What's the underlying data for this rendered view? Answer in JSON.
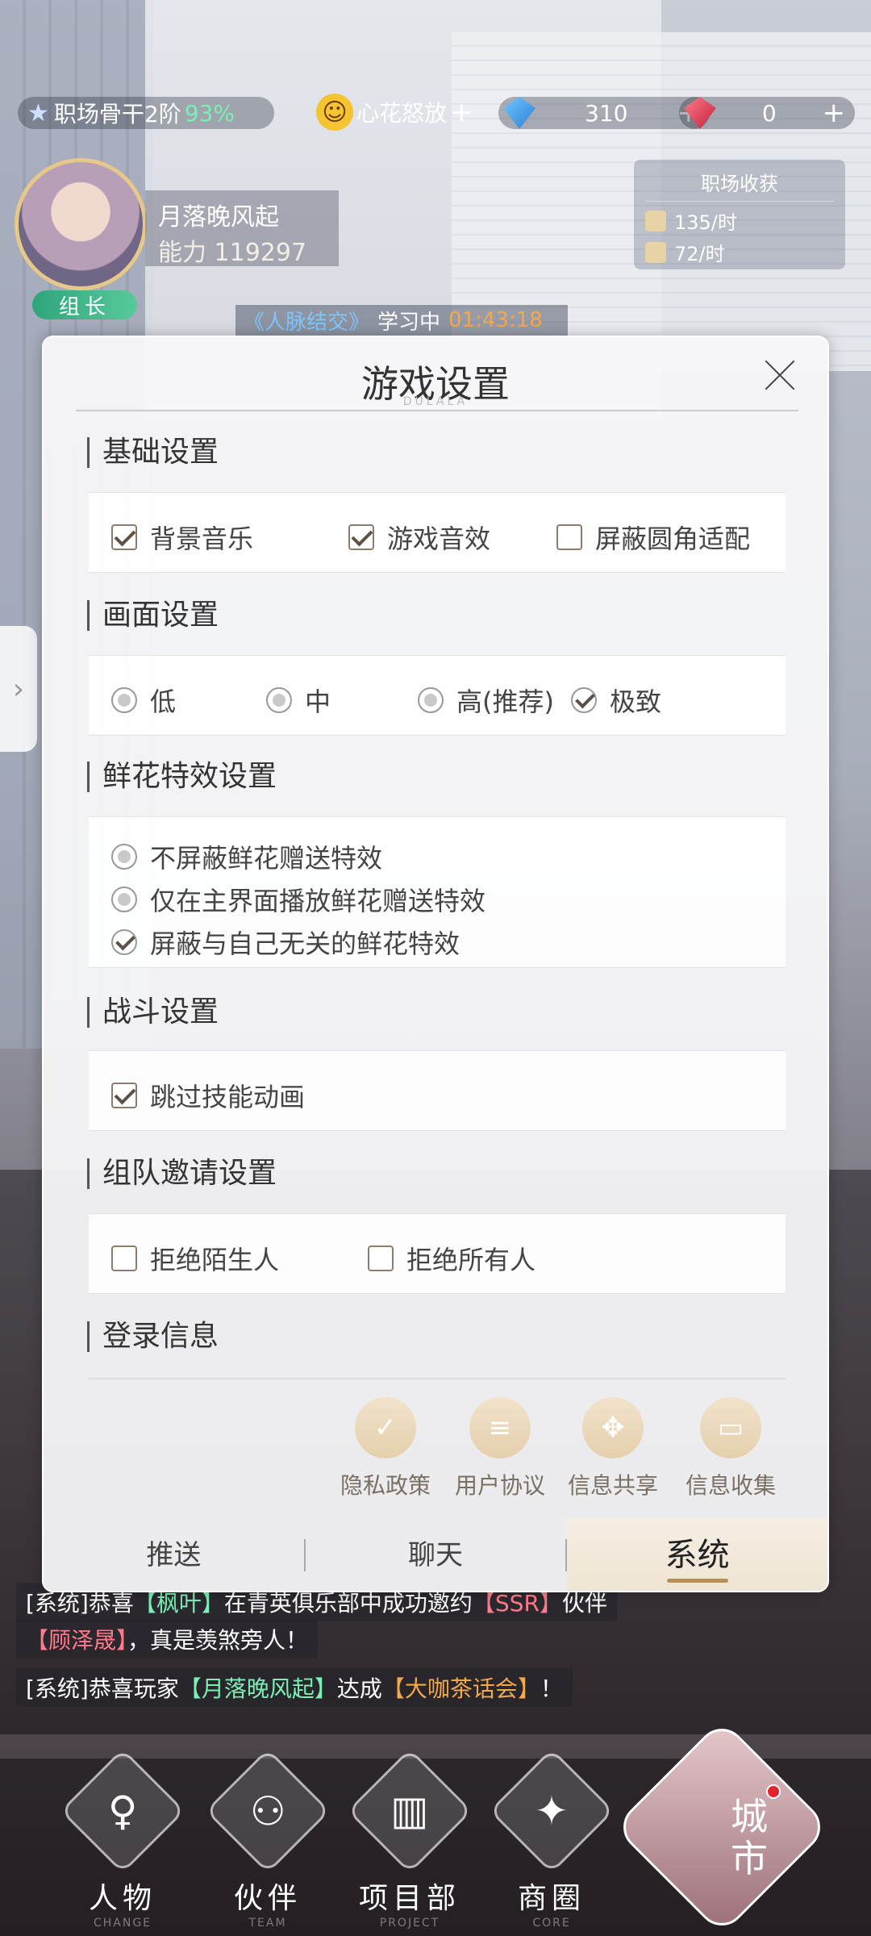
{
  "top_bar": {
    "rank_label": "职场骨干2阶",
    "rank_percent": "93%",
    "mood_label": "心花怒放",
    "mood_plus": "+",
    "blue_gem_count": "310",
    "blue_gem_plus": "+",
    "red_gem_count": "0",
    "red_gem_plus": "+"
  },
  "player": {
    "name": "月落晚风起",
    "power": "能力 119297",
    "role_badge": "组长"
  },
  "harvest": {
    "title": "职场收获",
    "rate_1": "135/时",
    "rate_2": "72/时"
  },
  "learn_banner": {
    "book": "《人脉结交》",
    "status": "学习中",
    "timer": "01:43:18"
  },
  "dialog": {
    "title": "游戏设置",
    "subtitle": "DULALA",
    "sections": {
      "basic": {
        "heading": "基础设置",
        "bg_music": "背景音乐",
        "game_sfx": "游戏音效",
        "round_corner": "屏蔽圆角适配"
      },
      "graphics": {
        "heading": "画面设置",
        "low": "低",
        "mid": "中",
        "high": "高(推荐)",
        "ultra": "极致"
      },
      "flower": {
        "heading": "鲜花特效设置",
        "opt1": "不屏蔽鲜花赠送特效",
        "opt2": "仅在主界面播放鲜花赠送特效",
        "opt3": "屏蔽与自己无关的鲜花特效"
      },
      "battle": {
        "heading": "战斗设置",
        "skip_anim": "跳过技能动画"
      },
      "team": {
        "heading": "组队邀请设置",
        "reject_strangers": "拒绝陌生人",
        "reject_all": "拒绝所有人"
      },
      "login": {
        "heading": "登录信息",
        "privacy": "隐私政策",
        "agreement": "用户协议",
        "info_share": "信息共享",
        "info_collect": "信息收集"
      }
    },
    "tabs": [
      "推送",
      "聊天",
      "系统"
    ]
  },
  "chat": {
    "line1_prefix": "[系统]恭喜",
    "line1_name": "【枫叶】",
    "line1_mid": "在青英俱乐部中成功邀约",
    "line1_ssr": "【SSR】",
    "line1_suffix": "伙伴",
    "line2_name": "【顾泽晟】",
    "line2_suffix": "，真是羡煞旁人！",
    "line3_prefix": "[系统]恭喜玩家",
    "line3_name": "【月落晚风起】",
    "line3_mid": "达成",
    "line3_event": "【大咖茶话会】",
    "line3_suffix": "！"
  },
  "bottom_nav": {
    "items": [
      {
        "label": "人物",
        "sub": "CHANGE"
      },
      {
        "label": "伙伴",
        "sub": "TEAM"
      },
      {
        "label": "项目部",
        "sub": "PROJECT"
      },
      {
        "label": "商圈",
        "sub": "CORE"
      }
    ],
    "city": "城市"
  },
  "colors": {
    "accent_gold": "#b69056",
    "green_text": "#7af0b5",
    "orange_text": "#f3a84b"
  }
}
